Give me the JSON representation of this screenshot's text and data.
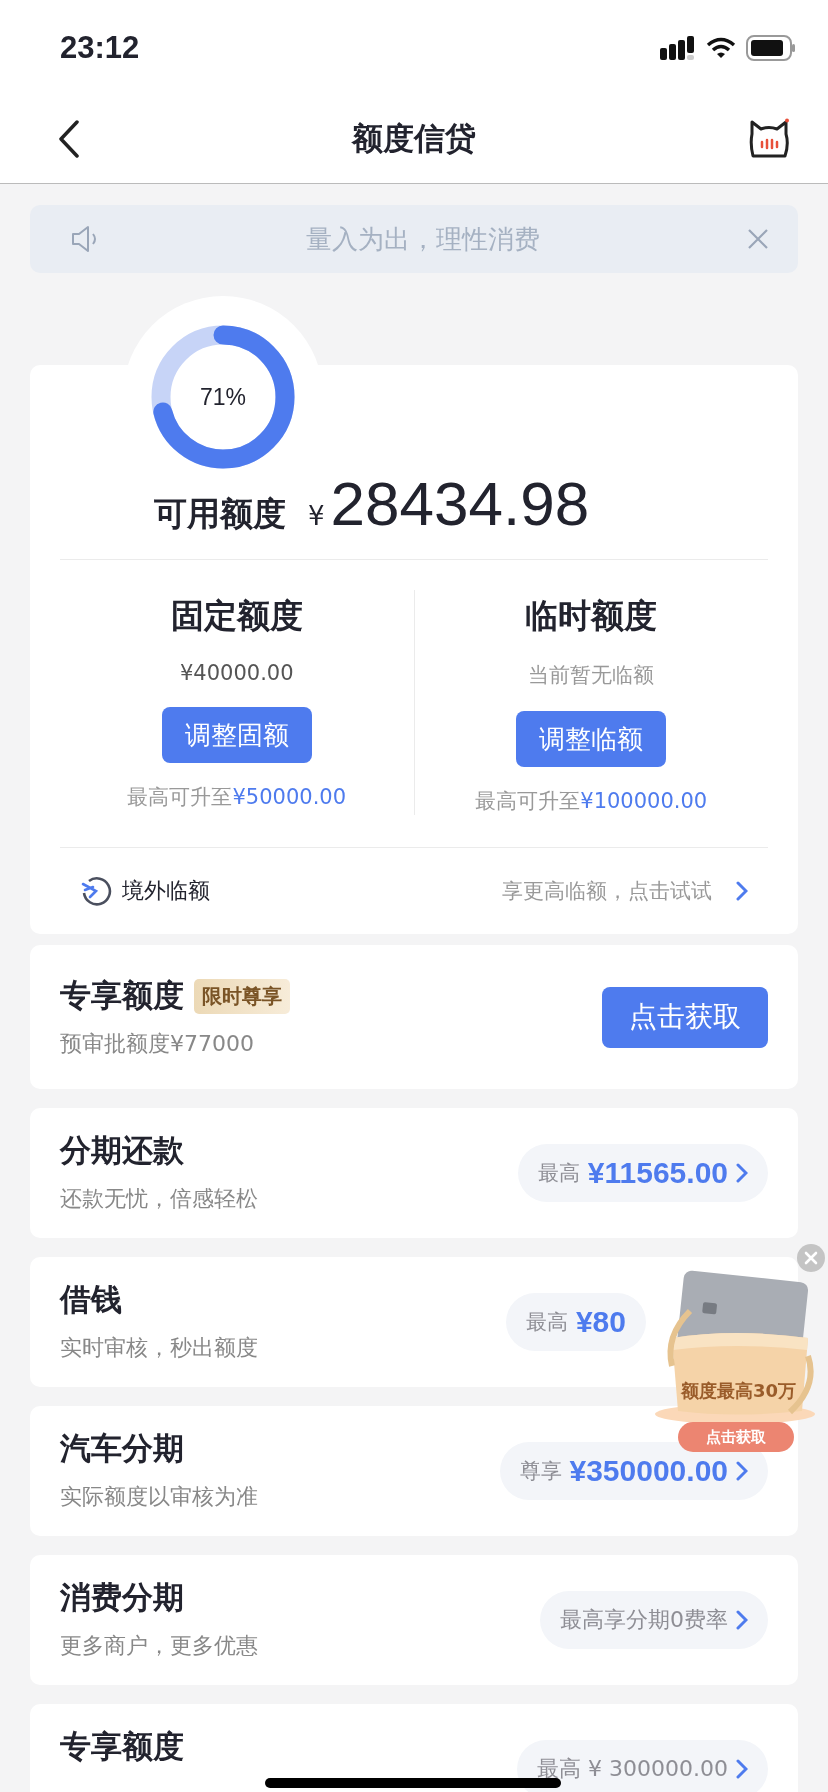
{
  "status_bar": {
    "time": "23:12"
  },
  "nav": {
    "title": "额度信贷"
  },
  "notice": {
    "text": "量入为出，理性消费"
  },
  "available": {
    "percent_text": "71%",
    "label": "可用额度",
    "currency": "¥",
    "amount": "28434.98"
  },
  "quotas": [
    {
      "title": "固定额度",
      "value": "¥40000.00",
      "kind": "amount",
      "button": "调整固额",
      "note": "最高可升至",
      "note_amount": "¥50000.00"
    },
    {
      "title": "临时额度",
      "value": "当前暂无临额",
      "kind": "empty",
      "button": "调整临额",
      "note": "最高可升至",
      "note_amount": "¥100000.00"
    }
  ],
  "overseas": {
    "label": "境外临额",
    "hint": "享更高临额，点击试试"
  },
  "exclusive": {
    "title": "专享额度",
    "tag": "限时尊享",
    "subtitle": "预审批额度¥77000",
    "button": "点击获取"
  },
  "products": [
    {
      "title": "分期还款",
      "subtitle": "还款无忧，倍感轻松",
      "kind": "amount",
      "prefix": "最高",
      "value": "¥11565.00"
    },
    {
      "title": "借钱",
      "subtitle": "实时审核，秒出额度",
      "kind": "covered",
      "prefix": "最高",
      "value": "¥80"
    },
    {
      "title": "汽车分期",
      "subtitle": "实际额度以审核为准",
      "kind": "amount",
      "prefix": "尊享",
      "value": "¥350000.00"
    },
    {
      "title": "消费分期",
      "subtitle": "更多商户，更多优惠",
      "kind": "plain",
      "prefix": "最高享分期0费率"
    },
    {
      "title": "专享额度",
      "kind": "plain",
      "prefix": "最高 ¥ 300000.00"
    }
  ],
  "promo": {
    "caption": "额度最高30万",
    "button": "点击获取"
  }
}
